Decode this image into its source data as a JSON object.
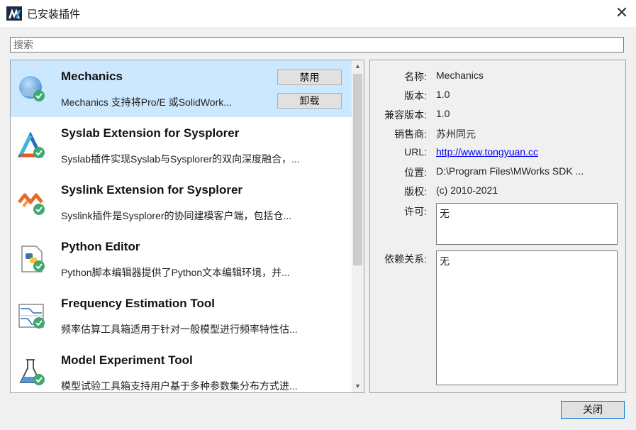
{
  "window": {
    "title": "已安装插件",
    "logo_icon": "mworks-logo",
    "close_icon": "close-icon"
  },
  "search": {
    "placeholder": "搜索",
    "value": ""
  },
  "plugins": [
    {
      "name": "Mechanics",
      "description": "Mechanics 支持将Pro/E 或SolidWork...",
      "icon": "mechanics-icon",
      "selected": true,
      "buttons": {
        "disable": "禁用",
        "uninstall": "卸载"
      }
    },
    {
      "name": "Syslab Extension for Sysplorer",
      "description": "Syslab插件实现Syslab与Sysplorer的双向深度融合，...",
      "icon": "syslab-icon"
    },
    {
      "name": "Syslink Extension for Sysplorer",
      "description": "Syslink插件是Sysplorer的协同建模客户端，包括仓...",
      "icon": "syslink-icon"
    },
    {
      "name": "Python Editor",
      "description": "Python脚本编辑器提供了Python文本编辑环境，并...",
      "icon": "python-icon"
    },
    {
      "name": "Frequency Estimation Tool",
      "description": "频率估算工具箱适用于针对一般模型进行频率特性估...",
      "icon": "frequency-chart-icon"
    },
    {
      "name": "Model Experiment Tool",
      "description": "模型试验工具箱支持用户基于多种参数集分布方式进...",
      "icon": "flask-icon"
    }
  ],
  "details": {
    "name_label": "名称:",
    "name_value": "Mechanics",
    "version_label": "版本:",
    "version_value": "1.0",
    "compat_label": "兼容版本:",
    "compat_value": "1.0",
    "vendor_label": "销售商:",
    "vendor_value": "苏州同元",
    "url_label": "URL:",
    "url_value": "http://www.tongyuan.cc",
    "location_label": "位置:",
    "location_value": "D:\\Program Files\\MWorks SDK ...",
    "copyright_label": "版权:",
    "copyright_value": "(c) 2010-2021",
    "license_label": "许可:",
    "license_value": "无",
    "deps_label": "依赖关系:",
    "deps_value": "无"
  },
  "footer": {
    "close_label": "关闭"
  },
  "colors": {
    "selection": "#cce8ff",
    "link": "#0000ee",
    "check_badge": "#3ea86f"
  }
}
